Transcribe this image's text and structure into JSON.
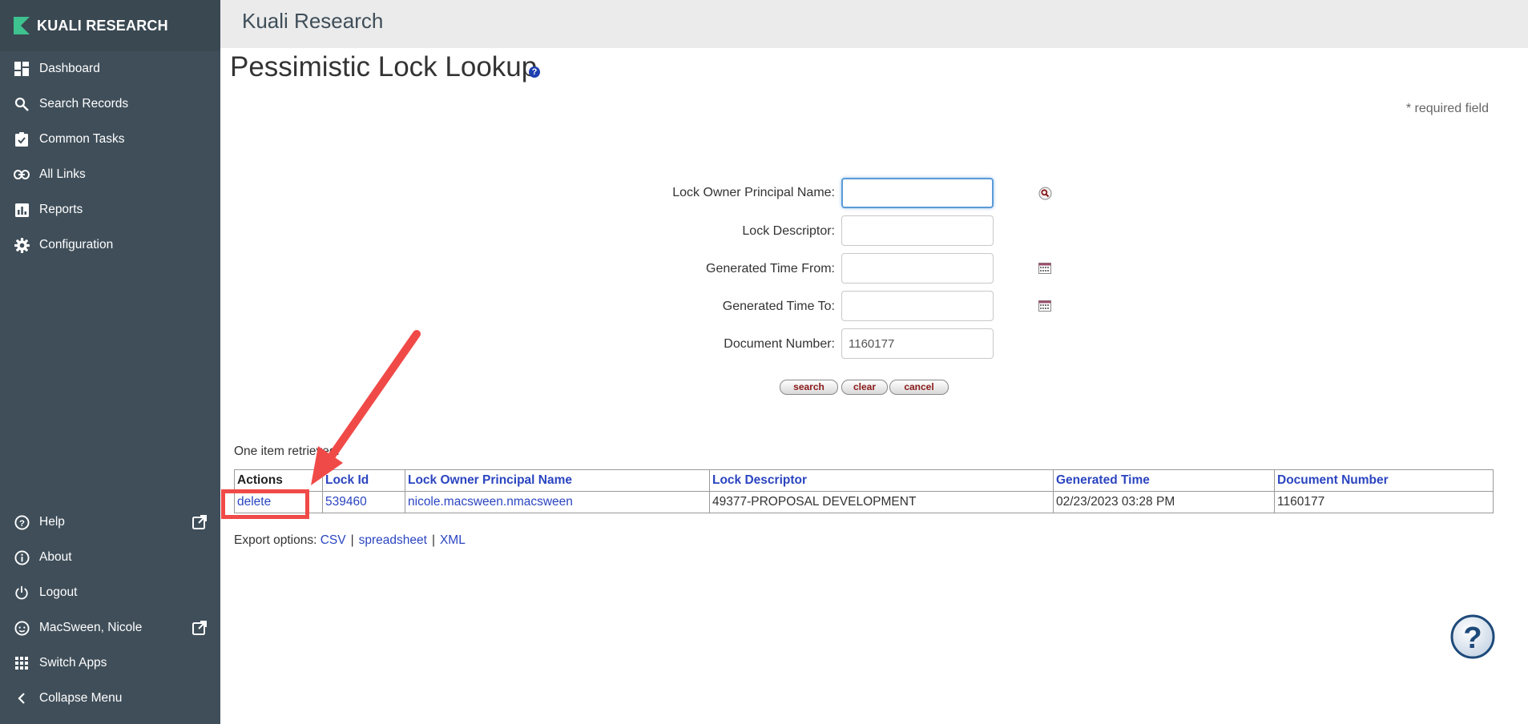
{
  "brand": {
    "name": "KUALI RESEARCH"
  },
  "sidebar": {
    "items": [
      {
        "label": "Dashboard",
        "icon": "dashboard-icon"
      },
      {
        "label": "Search Records",
        "icon": "search-icon"
      },
      {
        "label": "Common Tasks",
        "icon": "clipboard-check-icon"
      },
      {
        "label": "All Links",
        "icon": "link-icon"
      },
      {
        "label": "Reports",
        "icon": "bar-chart-icon"
      },
      {
        "label": "Configuration",
        "icon": "gear-icon"
      }
    ],
    "bottom_items": [
      {
        "label": "Help",
        "icon": "help-circle-icon",
        "external": true
      },
      {
        "label": "About",
        "icon": "info-icon"
      },
      {
        "label": "Logout",
        "icon": "power-icon"
      },
      {
        "label": "MacSween, Nicole",
        "icon": "user-face-icon",
        "external": true
      },
      {
        "label": "Switch Apps",
        "icon": "grid-icon"
      },
      {
        "label": "Collapse Menu",
        "icon": "chevron-left-icon"
      }
    ]
  },
  "header": {
    "app_title": "Kuali Research"
  },
  "page": {
    "title": "Pessimistic Lock Lookup",
    "help_glyph": "?",
    "required_note": "* required field"
  },
  "form": {
    "fields": [
      {
        "label": "Lock Owner Principal Name:",
        "value": ""
      },
      {
        "label": "Lock Descriptor:",
        "value": ""
      },
      {
        "label": "Generated Time From:",
        "value": ""
      },
      {
        "label": "Generated Time To:",
        "value": ""
      },
      {
        "label": "Document Number:",
        "value": "1160177"
      }
    ],
    "buttons": {
      "search": "search",
      "clear": "clear",
      "cancel": "cancel"
    }
  },
  "results": {
    "summary": "One item retrieved.",
    "headers": [
      "Actions",
      "Lock Id",
      "Lock Owner Principal Name",
      "Lock Descriptor",
      "Generated Time",
      "Document Number"
    ],
    "rows": [
      {
        "action": "delete",
        "lock_id": "539460",
        "owner": "nicole.macsween.nmacsween",
        "descriptor": "49377-PROPOSAL DEVELOPMENT",
        "generated_time": "02/23/2023 03:28 PM",
        "document_number": "1160177"
      }
    ]
  },
  "export": {
    "label": "Export options:",
    "options": [
      "CSV",
      "spreadsheet",
      "XML"
    ],
    "separator": "|"
  },
  "colors": {
    "sidebar_bg": "#3f4e59",
    "brand_accent": "#3ec28f",
    "link": "#2b45c0",
    "annotation": "#f04a48"
  }
}
